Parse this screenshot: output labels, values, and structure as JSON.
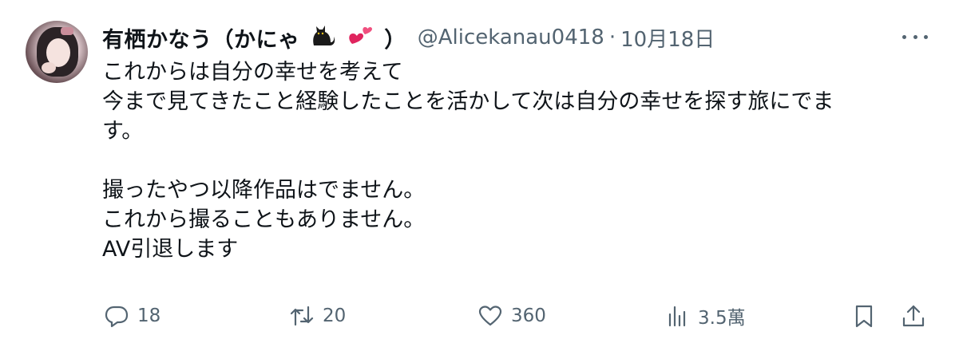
{
  "tweet": {
    "display_name": "有栖かなう（かにゃ",
    "display_name_close": "）",
    "name_emojis": [
      "cat-icon",
      "hearts-icon"
    ],
    "handle": "@Alicekanau0418",
    "separator": "·",
    "date": "10月18日",
    "body_lines": [
      "これからは自分の幸せを考えて",
      "今まで見てきたこと経験したことを活かして次は自分の幸せを探す旅にでま",
      "す。",
      "",
      "撮ったやつ以降作品はでません。",
      "これから撮ることもありません。",
      "AV引退します"
    ]
  },
  "actions": {
    "reply_icon": "reply-icon",
    "reply_count": "18",
    "retweet_icon": "retweet-icon",
    "retweet_count": "20",
    "like_icon": "heart-icon",
    "like_count": "360",
    "views_icon": "analytics-icon",
    "views_count": "3.5萬",
    "bookmark_icon": "bookmark-icon",
    "share_icon": "share-icon"
  },
  "colors": {
    "text_primary": "#0f1419",
    "text_secondary": "#536471",
    "background": "#ffffff",
    "heart_emoji": "#e0245e"
  }
}
